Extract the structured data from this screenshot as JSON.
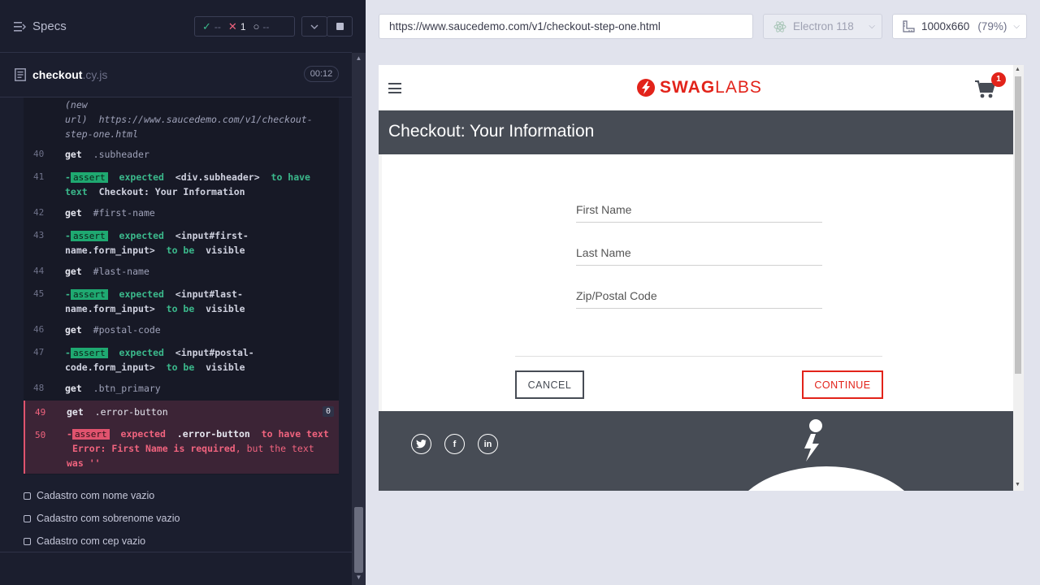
{
  "reporter": {
    "specs_label": "Specs",
    "stats": {
      "passed_icon": "✓",
      "passed": "--",
      "failed_icon": "✕",
      "failed": "1",
      "pending_icon": "○",
      "pending": "--"
    },
    "spec_file": {
      "name": "checkout",
      "ext": ".cy.js",
      "duration": "00:12"
    },
    "commands": [
      {
        "line1": "(new",
        "line2_a": "url)",
        "line2_b": "https://www.saucedemo.com/v1/checkout-",
        "line3": "step-one.html"
      },
      {
        "num": "40",
        "name": "get",
        "sel": ".subheader"
      },
      {
        "num": "41",
        "badge": "assert",
        "expected": "expected",
        "subject": "<div.subheader>",
        "to_have": "to have",
        "text_word": "text",
        "value": "Checkout: Your Information"
      },
      {
        "num": "42",
        "name": "get",
        "sel": "#first-name"
      },
      {
        "num": "43",
        "badge": "assert",
        "expected": "expected",
        "subject": "<input#first-",
        "subject2": "name.form_input>",
        "to_be": "to be",
        "value": "visible"
      },
      {
        "num": "44",
        "name": "get",
        "sel": "#last-name"
      },
      {
        "num": "45",
        "badge": "assert",
        "expected": "expected",
        "subject": "<input#last-",
        "subject2": "name.form_input>",
        "to_be": "to be",
        "value": "visible"
      },
      {
        "num": "46",
        "name": "get",
        "sel": "#postal-code"
      },
      {
        "num": "47",
        "badge": "assert",
        "expected": "expected",
        "subject": "<input#postal-",
        "subject2": "code.form_input>",
        "to_be": "to be",
        "value": "visible"
      },
      {
        "num": "48",
        "name": "get",
        "sel": ".btn_primary"
      },
      {
        "num": "49",
        "name": "get",
        "sel": ".error-button",
        "count": "0"
      },
      {
        "num": "50",
        "badge": "assert",
        "expected": "expected",
        "subject": ".error-button",
        "to_have": "to have text",
        "value": "Error: First Name is required",
        "tail": ", but the text",
        "tail2": "was",
        "quote": "''"
      }
    ],
    "tests": [
      "Cadastro com nome vazio",
      "Cadastro com sobrenome vazio",
      "Cadastro com cep vazio"
    ]
  },
  "aut": {
    "url": "https://www.saucedemo.com/v1/checkout-step-one.html",
    "browser": "Electron 118",
    "viewport": "1000x660",
    "zoom": "(79%)",
    "app": {
      "logo_a": "SWAG",
      "logo_b": "LABS",
      "cart_count": "1",
      "subheader": "Checkout: Your Information",
      "first_name_placeholder": "First Name",
      "last_name_placeholder": "Last Name",
      "postal_placeholder": "Zip/Postal Code",
      "cancel": "CANCEL",
      "continue": "CONTINUE",
      "social": [
        "twitter-icon",
        "facebook-icon",
        "linkedin-icon"
      ]
    }
  },
  "colors": {
    "brand_red": "#e2231a",
    "pass_green": "#3bb98c",
    "fail_red": "#f0637e",
    "reporter_bg": "#1b1e2e"
  }
}
